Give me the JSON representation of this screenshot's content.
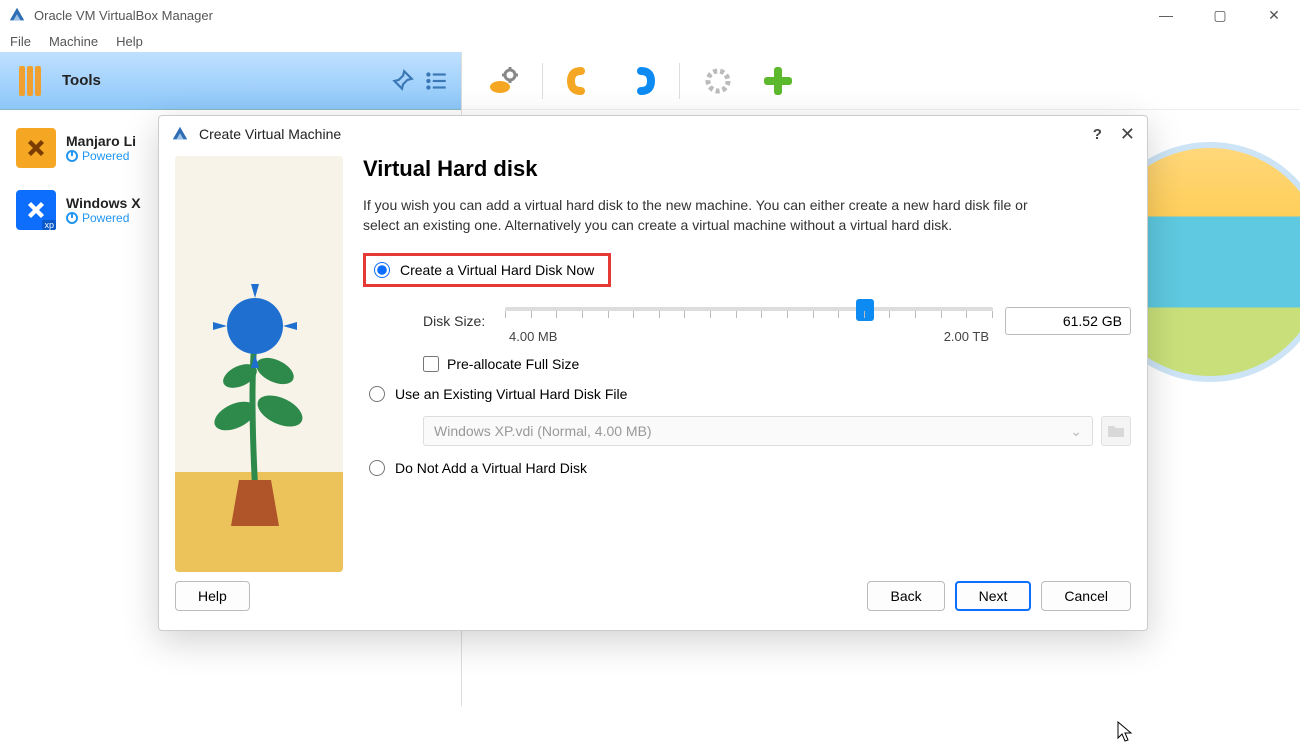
{
  "main_window": {
    "title": "Oracle VM VirtualBox Manager",
    "menu": [
      "File",
      "Machine",
      "Help"
    ]
  },
  "sidebar": {
    "tools_label": "Tools",
    "vms": [
      {
        "name": "Manjaro Li",
        "state": "Powered"
      },
      {
        "name": "Windows X",
        "state": "Powered"
      }
    ]
  },
  "dialog": {
    "title": "Create Virtual Machine",
    "heading": "Virtual Hard disk",
    "description": "If you wish you can add a virtual hard disk to the new machine. You can either create a new hard disk file or select an existing one. Alternatively you can create a virtual machine without a virtual hard disk.",
    "options": {
      "create_now": "Create a Virtual Hard Disk Now",
      "use_existing": "Use an Existing Virtual Hard Disk File",
      "no_disk": "Do Not Add a Virtual Hard Disk"
    },
    "disk_size_label": "Disk Size:",
    "slider_min": "4.00 MB",
    "slider_max": "2.00 TB",
    "size_value": "61.52 GB",
    "preallocate_label": "Pre-allocate Full Size",
    "existing_file": "Windows XP.vdi (Normal, 4.00 MB)",
    "buttons": {
      "help": "Help",
      "back": "Back",
      "next": "Next",
      "cancel": "Cancel"
    }
  }
}
